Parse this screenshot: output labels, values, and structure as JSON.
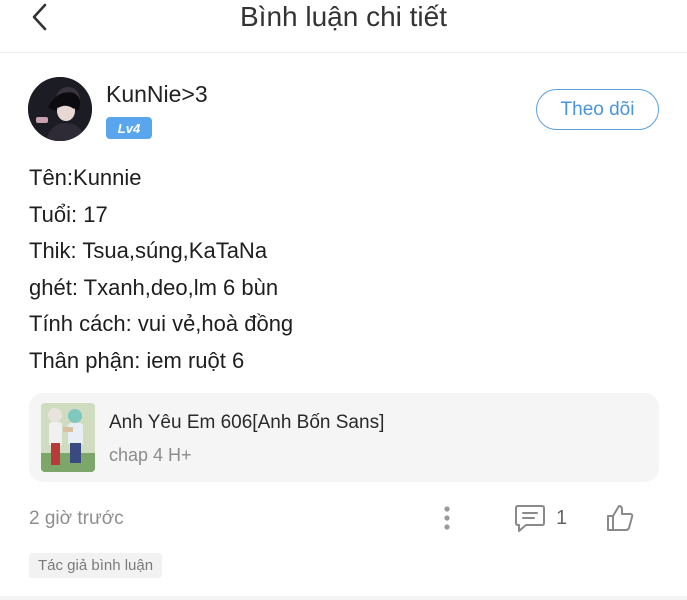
{
  "header": {
    "title": "Bình luận chi tiết",
    "back_icon": "chevron-left-icon"
  },
  "comment": {
    "username": "KunNie>3",
    "level": "Lv4",
    "follow_label": "Theo dõi",
    "lines": [
      "Tên:Kunnie",
      "Tuổi: 17",
      "Thik: Tsua,súng,KaTaNa",
      "ghét: Txanh,deo,lm 6 bùn",
      "Tính cách: vui vẻ,hoà đồng",
      "Thân phận: iem ruột 6"
    ],
    "story": {
      "title": "Anh Yêu Em 606[Anh Bốn Sans]",
      "chapter": "chap 4 H+"
    },
    "time": "2 giờ trước",
    "reply_count": "1",
    "author_tag": "Tác giả bình luận"
  },
  "colors": {
    "accent": "#4a94dc",
    "level_badge": "#5aa6ee",
    "muted_text": "#8e8e8e",
    "card_bg": "#f5f5f6"
  },
  "icons": {
    "more": "more-vertical-icon",
    "reply": "comment-icon",
    "like": "thumbs-up-icon"
  }
}
